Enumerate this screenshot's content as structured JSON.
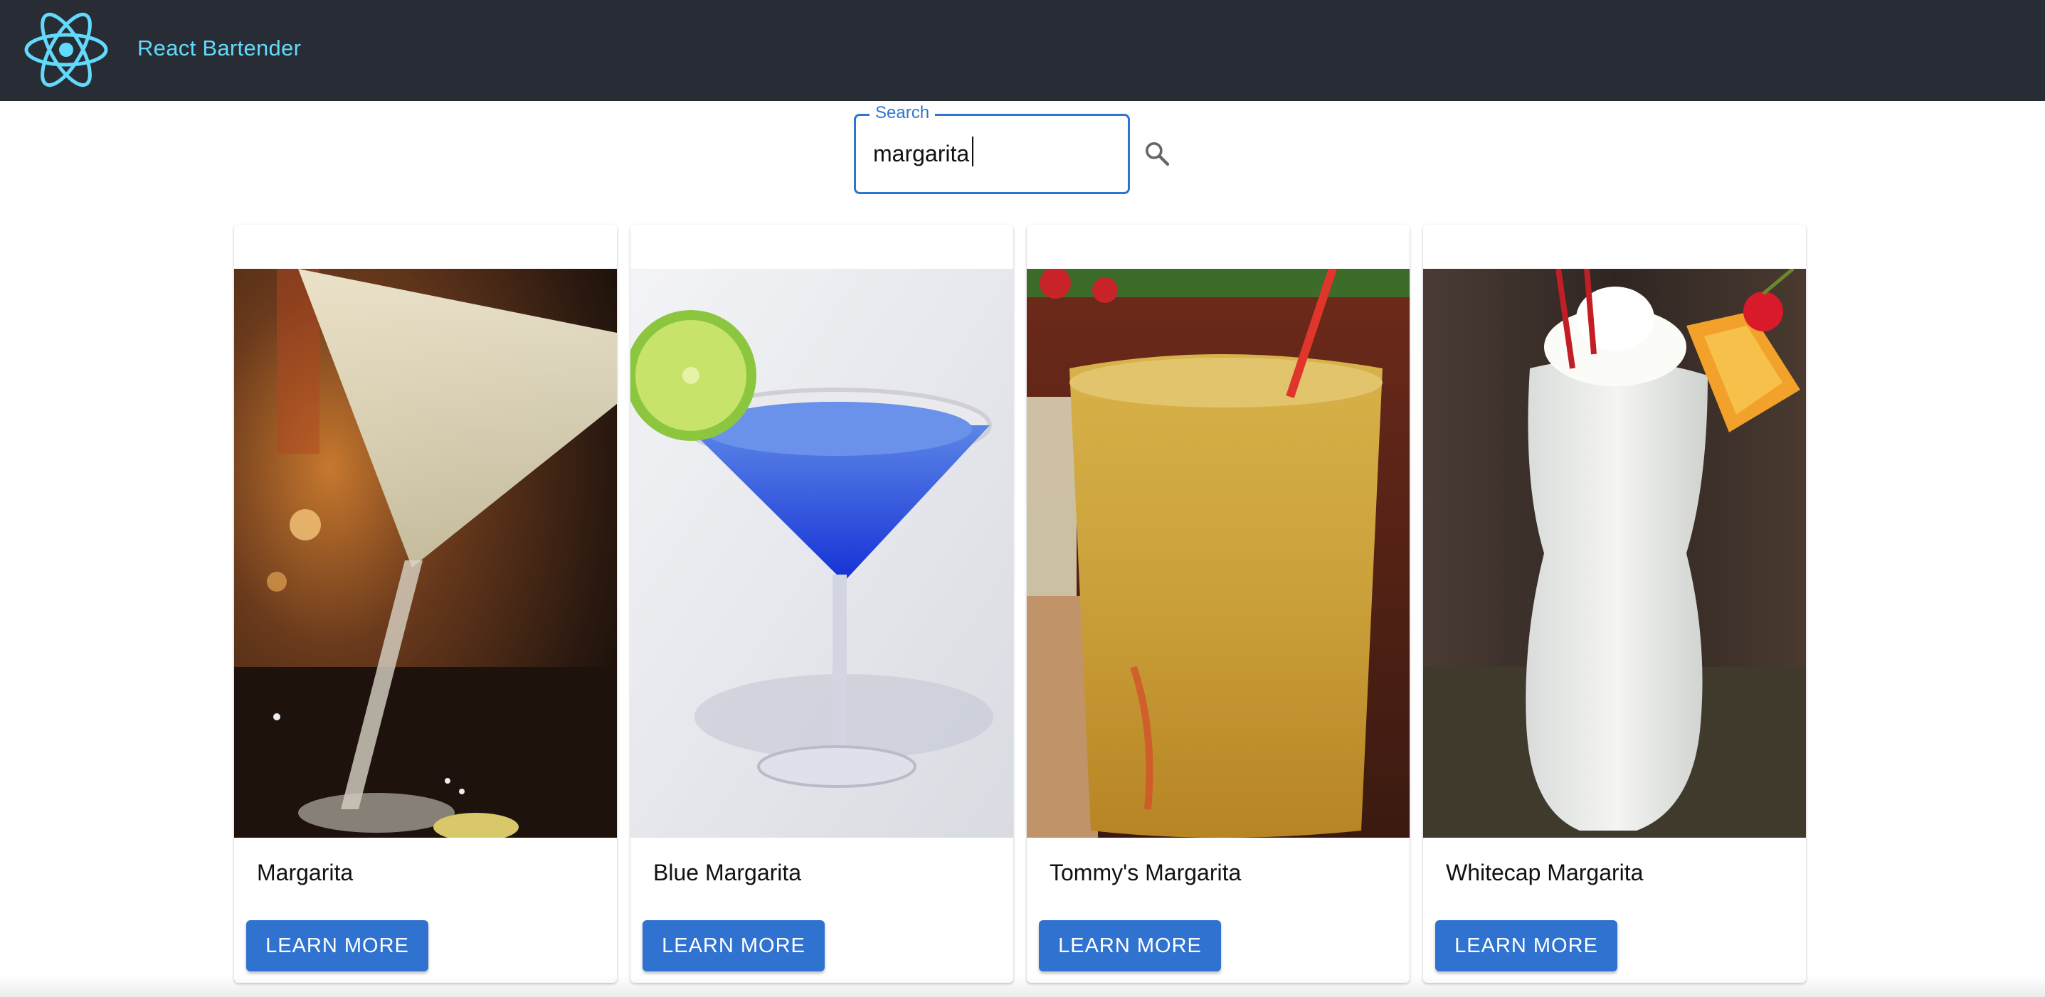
{
  "header": {
    "app_title": "React Bartender",
    "logo_icon": "react-atom-logo-icon",
    "accent_color": "#61dafb",
    "background_color": "#282c34"
  },
  "search": {
    "label": "Search",
    "value": "margarita",
    "search_icon": "search-icon",
    "border_color": "#2e75d0"
  },
  "cocktails": [
    {
      "name": "Margarita",
      "button_label": "LEARN MORE"
    },
    {
      "name": "Blue Margarita",
      "button_label": "LEARN MORE"
    },
    {
      "name": "Tommy's Margarita",
      "button_label": "LEARN MORE"
    },
    {
      "name": "Whitecap Margarita",
      "button_label": "LEARN MORE"
    }
  ],
  "button_color": "#2f72cf"
}
